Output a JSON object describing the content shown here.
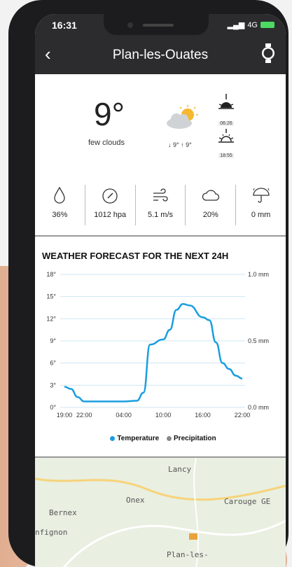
{
  "status": {
    "time": "16:31",
    "network": "4G"
  },
  "nav": {
    "title": "Plan-les-Ouates"
  },
  "current": {
    "temperature": "9°",
    "description": "few clouds",
    "minmax": "↓ 9° ↑ 9°",
    "sunrise": "06:26",
    "sunset": "18:55"
  },
  "stats": {
    "humidity": "36%",
    "pressure": "1012 hpa",
    "wind": "5.1 m/s",
    "clouds": "20%",
    "rain": "0 mm"
  },
  "chart_data": {
    "type": "line",
    "title": "WEATHER FORECAST FOR THE NEXT 24H",
    "x_ticks": [
      "19:00",
      "22:00",
      "04:00",
      "10:00",
      "16:00",
      "22:00"
    ],
    "y_ticks_left": [
      "18°",
      "15°",
      "12°",
      "9°",
      "6°",
      "3°",
      "0°"
    ],
    "y_ticks_right": [
      "1.0 mm",
      "0.5 mm",
      "0.0 mm"
    ],
    "ylim_left": [
      0,
      18
    ],
    "ylim_right": [
      0,
      1.0
    ],
    "grid": true,
    "legend_position": "bottom",
    "series": [
      {
        "name": "Temperature",
        "color": "#1a9ee0",
        "x": [
          "19:00",
          "20:00",
          "21:00",
          "22:00",
          "01:00",
          "04:00",
          "06:00",
          "07:00",
          "08:00",
          "10:00",
          "11:00",
          "12:00",
          "13:00",
          "14:00",
          "16:00",
          "17:00",
          "18:00",
          "19:00",
          "20:00",
          "21:00",
          "22:00"
        ],
        "values": [
          2.8,
          2.5,
          1.4,
          0.8,
          0.8,
          0.8,
          0.9,
          2.0,
          8.5,
          9.2,
          10.5,
          13.2,
          14.0,
          13.8,
          12.2,
          11.8,
          8.8,
          6.0,
          5.2,
          4.3,
          3.9
        ]
      },
      {
        "name": "Precipitation",
        "color": "#888888",
        "values": []
      }
    ]
  },
  "legend": {
    "temperature": "Temperature",
    "precipitation": "Precipitation"
  },
  "map": {
    "labels": [
      "Lancy",
      "Onex",
      "Carouge GE",
      "Bernex",
      "nfignon",
      "Plan-les-"
    ]
  }
}
